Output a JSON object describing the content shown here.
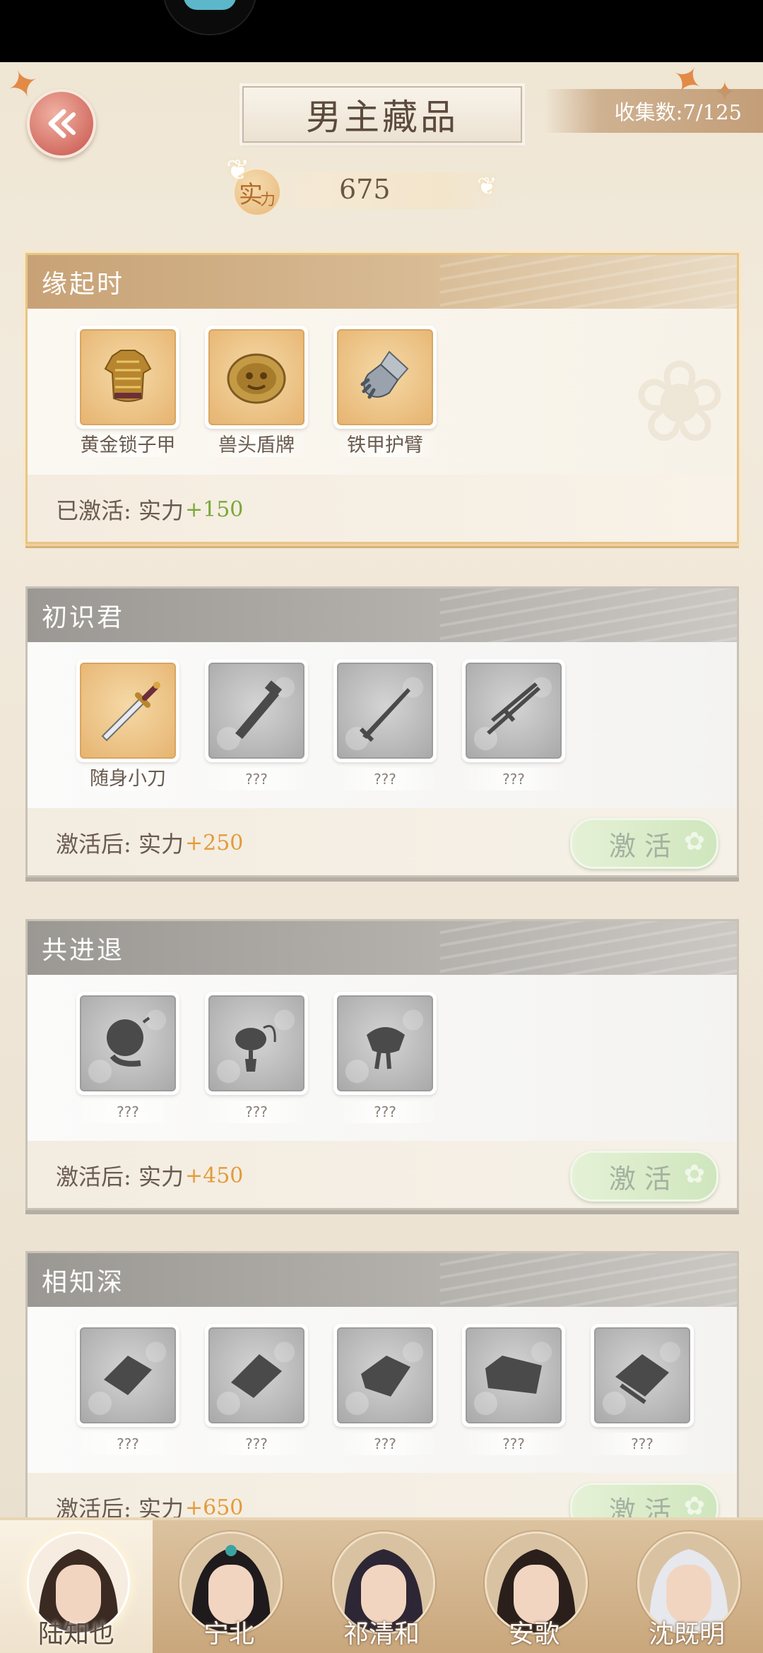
{
  "header": {
    "title": "男主藏品",
    "collection_label": "收集数:7/125",
    "power_seal_big": "实",
    "power_seal_small": "力",
    "power_value": "675"
  },
  "icons": {
    "back": "back-arrow-icon",
    "maple_leaf": "maple-leaf-icon",
    "butterfly": "butterfly-icon"
  },
  "colors": {
    "bonus_active": "#79a83a",
    "bonus_inactive": "#e39b3a",
    "activate_button": "#cfe6bd",
    "gold_header": "#c8a276",
    "gray_header": "#9b9893"
  },
  "sets": [
    {
      "title": "缘起时",
      "state": "activated",
      "items": [
        {
          "name": "黄金锁子甲",
          "owned": true,
          "icon": "golden-armor-icon"
        },
        {
          "name": "兽头盾牌",
          "owned": true,
          "icon": "beast-shield-icon"
        },
        {
          "name": "铁甲护臂",
          "owned": true,
          "icon": "iron-gauntlet-icon"
        }
      ],
      "footer_label": "已激活: 实力",
      "bonus": "+150"
    },
    {
      "title": "初识君",
      "state": "locked",
      "items": [
        {
          "name": "随身小刀",
          "owned": true,
          "icon": "dagger-icon"
        },
        {
          "name": "???",
          "owned": false,
          "icon": "club-silhouette-icon"
        },
        {
          "name": "???",
          "owned": false,
          "icon": "sword-silhouette-icon"
        },
        {
          "name": "???",
          "owned": false,
          "icon": "crossed-swords-silhouette-icon"
        }
      ],
      "footer_label": "激活后: 实力",
      "bonus": "+250",
      "button": "激活"
    },
    {
      "title": "共进退",
      "state": "locked",
      "items": [
        {
          "name": "???",
          "owned": false,
          "icon": "round-pendant-silhouette-icon"
        },
        {
          "name": "???",
          "owned": false,
          "icon": "tassel-ornament-silhouette-icon"
        },
        {
          "name": "???",
          "owned": false,
          "icon": "pouch-silhouette-icon"
        }
      ],
      "footer_label": "激活后: 实力",
      "bonus": "+450",
      "button": "激活"
    },
    {
      "title": "相知深",
      "state": "locked",
      "items": [
        {
          "name": "???",
          "owned": false,
          "icon": "scroll-silhouette-icon"
        },
        {
          "name": "???",
          "owned": false,
          "icon": "letter-silhouette-icon"
        },
        {
          "name": "???",
          "owned": false,
          "icon": "folded-paper-silhouette-icon"
        },
        {
          "name": "???",
          "owned": false,
          "icon": "open-book-silhouette-icon"
        },
        {
          "name": "???",
          "owned": false,
          "icon": "papers-silhouette-icon"
        }
      ],
      "footer_label": "激活后: 实力",
      "bonus": "+650",
      "button": "激活"
    }
  ],
  "characters": [
    {
      "name": "陆知也",
      "active": true
    },
    {
      "name": "宁北",
      "active": false
    },
    {
      "name": "祁清和",
      "active": false
    },
    {
      "name": "安歌",
      "active": false
    },
    {
      "name": "沈既明",
      "active": false
    }
  ]
}
